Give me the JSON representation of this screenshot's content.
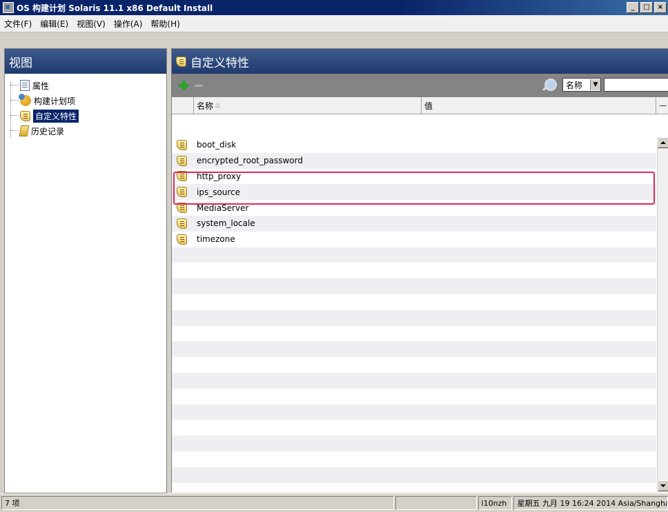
{
  "window": {
    "title": "OS 构建计划 Solaris 11.1 x86 Default Install",
    "min_label": "_",
    "max_label": "□",
    "close_label": "×"
  },
  "menu": [
    {
      "label": "文件(F)"
    },
    {
      "label": "编辑(E)"
    },
    {
      "label": "视图(V)"
    },
    {
      "label": "操作(A)"
    },
    {
      "label": "帮助(H)"
    }
  ],
  "left_panel": {
    "title": "视图",
    "items": [
      {
        "label": "属性",
        "icon": "document-icon"
      },
      {
        "label": "构建计划项",
        "icon": "build-items-icon"
      },
      {
        "label": "自定义特性",
        "icon": "tag-icon",
        "selected": true
      },
      {
        "label": "历史记录",
        "icon": "history-icon"
      }
    ]
  },
  "right_panel": {
    "title": "自定义特性",
    "search": {
      "select_value": "名称",
      "input_value": ""
    },
    "columns": {
      "name": "名称",
      "value": "值",
      "extra": "ᅳ"
    },
    "rows": [
      {
        "name": "boot_disk",
        "value": ""
      },
      {
        "name": "encrypted_root_password",
        "value": ""
      },
      {
        "name": "http_proxy",
        "value": ""
      },
      {
        "name": "ips_source",
        "value": ""
      },
      {
        "name": "MediaServer",
        "value": ""
      },
      {
        "name": "system_locale",
        "value": ""
      },
      {
        "name": "timezone",
        "value": ""
      }
    ],
    "blank_rows": 15
  },
  "status": {
    "count": "7 项",
    "user": "l10nzh",
    "datetime": "星期五 九月 19 16:24 2014 Asia/Shanghai"
  },
  "colors": {
    "title_bar": "#0a246a",
    "panel_header": "#2a4577",
    "highlight_box": "#e0265a",
    "add_green": "#2ea02e"
  }
}
